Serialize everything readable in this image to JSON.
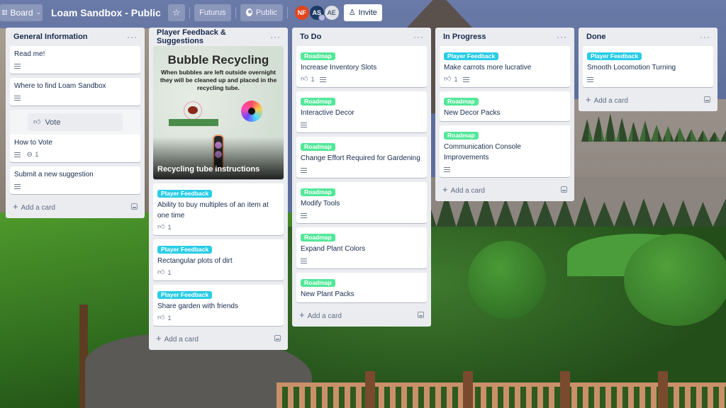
{
  "header": {
    "view_switcher_label": "Board",
    "board_title": "Loam Sandbox - Public",
    "team_label": "Futurus",
    "visibility_label": "Public",
    "members": [
      {
        "initials": "NF",
        "color": "#e0451e"
      },
      {
        "initials": "AS",
        "color": "#1d3a66"
      },
      {
        "initials": "AE",
        "color": "#dfe1e6"
      }
    ],
    "invite_label": "Invite"
  },
  "labels": {
    "player_feedback": {
      "text": "Player Feedback",
      "color": "#29cce5"
    },
    "roadmap": {
      "text": "Roadmap",
      "color": "#51e898"
    }
  },
  "common": {
    "add_card_label": "Add a card",
    "list_menu_glyph": "···"
  },
  "lists": [
    {
      "title": "General Information",
      "cards": [
        {
          "title": "Read me!",
          "has_description": true
        },
        {
          "title": "Where to find Loam Sandbox",
          "has_description": true
        },
        {
          "title": "How to Vote",
          "has_description": true,
          "attachments": "1",
          "vote_button_label": "Vote"
        },
        {
          "title": "Submit a new suggestion",
          "has_description": true
        }
      ]
    },
    {
      "title": "Player Feedback & Suggestions",
      "cover_card": {
        "title": "Recycling tube instructions",
        "image_heading": "Bubble Recycling",
        "image_text": "When bubbles are left outside overnight they will be cleaned up and placed in the recycling tube."
      },
      "cards": [
        {
          "label": "Player Feedback",
          "title": "Ability to buy multiples of an item at one time",
          "votes": "1"
        },
        {
          "label": "Player Feedback",
          "title": "Rectangular plots of dirt",
          "votes": "1"
        },
        {
          "label": "Player Feedback",
          "title": "Share garden with friends",
          "votes": "1"
        }
      ]
    },
    {
      "title": "To Do",
      "cards": [
        {
          "label": "Roadmap",
          "title": "Increase Inventory Slots",
          "votes": "1",
          "has_description": true
        },
        {
          "label": "Roadmap",
          "title": "Interactive Decor",
          "has_description": true
        },
        {
          "label": "Roadmap",
          "title": "Change Effort Required for Gardening",
          "has_description": true
        },
        {
          "label": "Roadmap",
          "title": "Modify Tools",
          "has_description": true
        },
        {
          "label": "Roadmap",
          "title": "Expand Plant Colors",
          "has_description": true
        },
        {
          "label": "Roadmap",
          "title": "New Plant Packs"
        }
      ]
    },
    {
      "title": "In Progress",
      "cards": [
        {
          "label": "Player Feedback",
          "title": "Make carrots more lucrative",
          "votes": "1",
          "has_description": true
        },
        {
          "label": "Roadmap",
          "title": "New Decor Packs"
        },
        {
          "label": "Roadmap",
          "title": "Communication Console Improvements",
          "has_description": true
        }
      ]
    },
    {
      "title": "Done",
      "cards": [
        {
          "label": "Player Feedback",
          "title": "Smooth Locomotion Turning",
          "has_description": true
        }
      ]
    }
  ]
}
